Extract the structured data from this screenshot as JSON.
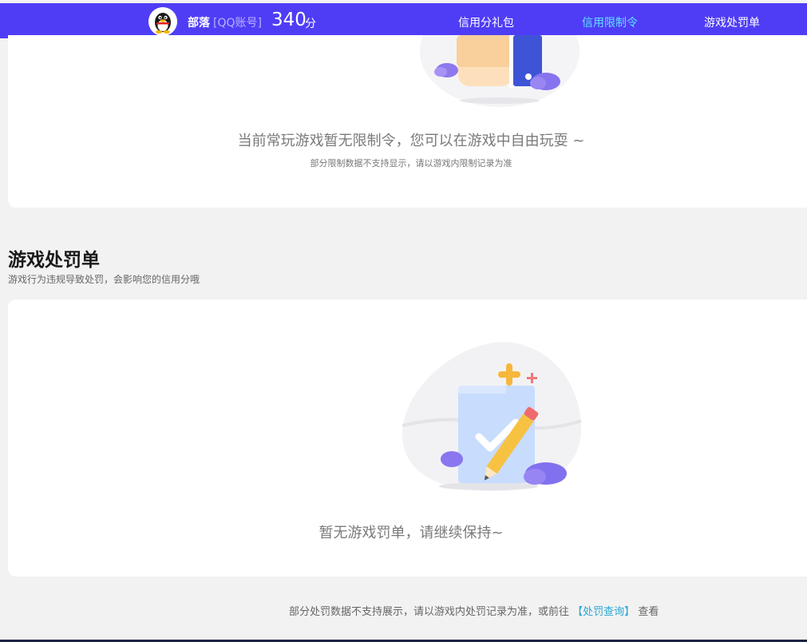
{
  "header": {
    "nickname": "部落",
    "account_type": "[QQ账号]",
    "score": "340",
    "score_unit": "分",
    "nav": [
      {
        "label": "信用分礼包",
        "active": false
      },
      {
        "label": "信用限制令",
        "active": true
      },
      {
        "label": "游戏处罚单",
        "active": false
      }
    ],
    "accent_color": "#5fe3ff",
    "bar_color": "#4f3df6"
  },
  "restriction_card": {
    "empty_text": "当前常玩游戏暂无限制令，您可以在游戏中自由玩耍 ~",
    "note": "部分限制数据不支持显示，请以游戏内限制记录为准",
    "illustration_icon": "hand-phone-illustration"
  },
  "penalty_section": {
    "title": "游戏处罚单",
    "subtitle": "游戏行为违规导致处罚，会影响您的信用分哦",
    "empty_text": "暂无游戏罚单，请继续保持~",
    "illustration_icon": "checklist-pencil-illustration"
  },
  "footer": {
    "note_prefix": "部分处罚数据不支持展示，请以游戏内处罚记录为准，或前往",
    "link_text": "【处罚查询】",
    "note_suffix": "查看"
  }
}
